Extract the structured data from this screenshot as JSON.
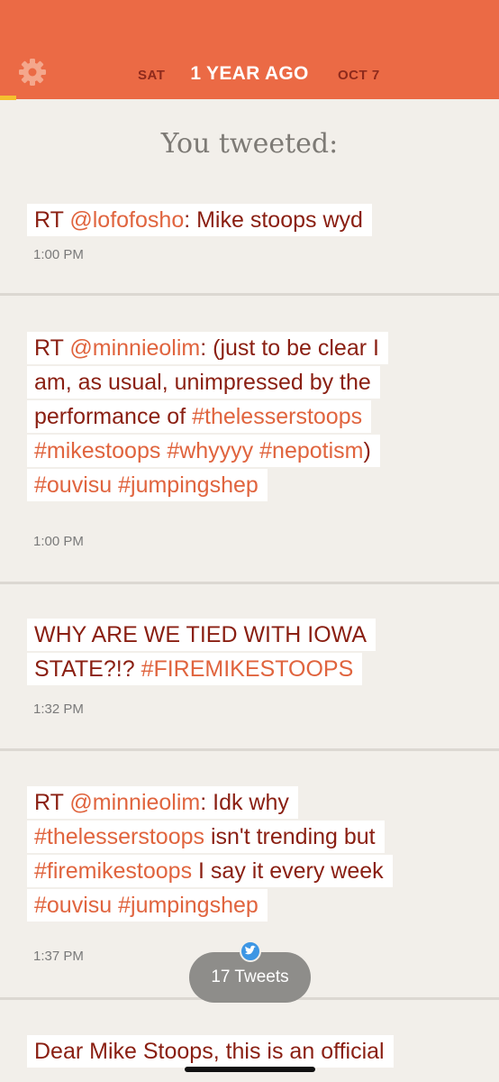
{
  "header": {
    "prev_day": "SAT",
    "title": "1 YEAR AGO",
    "next_day": "OCT 7",
    "accent_color": "#eb6a45",
    "settings_icon": "gear-icon"
  },
  "heading": "You tweeted:",
  "tweets": [
    {
      "lines": [
        [
          {
            "t": "RT "
          },
          {
            "t": "@lofofosho",
            "h": true
          },
          {
            "t": ": Mike stoops wyd"
          }
        ]
      ],
      "time": "1:00 PM"
    },
    {
      "lines": [
        [
          {
            "t": "RT "
          },
          {
            "t": "@minnieolim",
            "h": true
          },
          {
            "t": ": (just to be clear I"
          }
        ],
        [
          {
            "t": "am, as usual, unimpressed by the"
          }
        ],
        [
          {
            "t": "performance of "
          },
          {
            "t": "#thelesserstoops",
            "h": true
          }
        ],
        [
          {
            "t": "#mikestoops",
            "h": true
          },
          {
            "t": " "
          },
          {
            "t": "#whyyyy",
            "h": true
          },
          {
            "t": " "
          },
          {
            "t": "#nepotism",
            "h": true
          },
          {
            "t": ")"
          }
        ],
        [
          {
            "t": "#ouvisu",
            "h": true
          },
          {
            "t": " "
          },
          {
            "t": "#jumpingshep",
            "h": true
          }
        ]
      ],
      "time": "1:00 PM"
    },
    {
      "lines": [
        [
          {
            "t": "WHY ARE WE TIED WITH IOWA"
          }
        ],
        [
          {
            "t": "STATE?!? "
          },
          {
            "t": "#FIREMIKESTOOPS",
            "h": true
          }
        ]
      ],
      "time": "1:32 PM"
    },
    {
      "lines": [
        [
          {
            "t": "RT "
          },
          {
            "t": "@minnieolim",
            "h": true
          },
          {
            "t": ": Idk why"
          }
        ],
        [
          {
            "t": "#thelesserstoops",
            "h": true
          },
          {
            "t": " isn't trending but"
          }
        ],
        [
          {
            "t": "#firemikestoops",
            "h": true
          },
          {
            "t": " I say it every week"
          }
        ],
        [
          {
            "t": "#ouvisu",
            "h": true
          },
          {
            "t": " "
          },
          {
            "t": "#jumpingshep",
            "h": true
          }
        ]
      ],
      "time": "1:37 PM"
    },
    {
      "lines": [
        [
          {
            "t": "Dear Mike Stoops, this is an official"
          }
        ]
      ],
      "time": ""
    }
  ],
  "tweet_count_label": "17 Tweets",
  "tweet_count_icon": "twitter-bird-icon"
}
